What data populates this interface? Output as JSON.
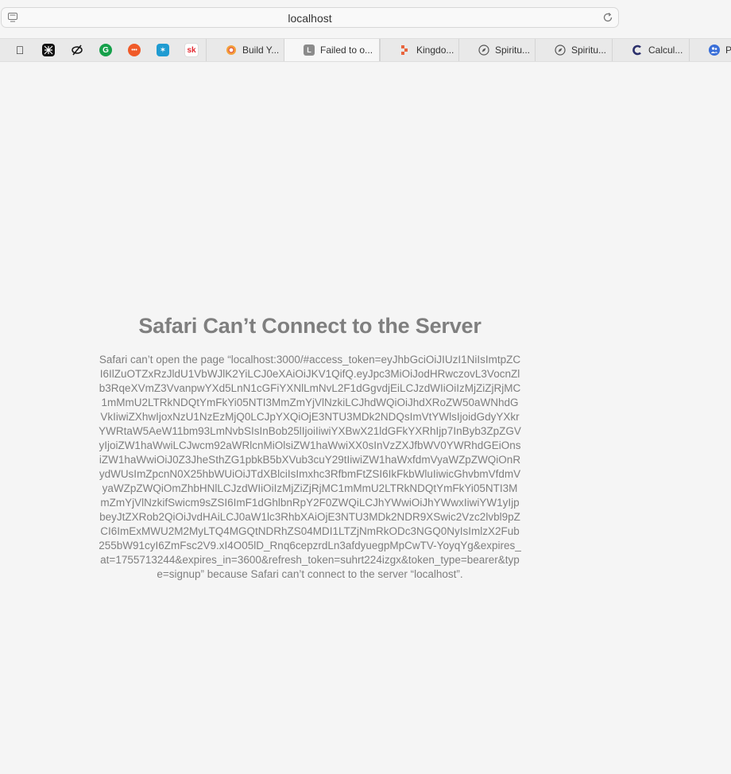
{
  "address_bar": {
    "url": "localhost"
  },
  "pinned_tabs": [
    {
      "icon": "apple-icon"
    },
    {
      "icon": "dark-pattern-icon"
    },
    {
      "icon": "perplexity-icon"
    },
    {
      "icon": "grammarly-icon"
    },
    {
      "icon": "orange-app-icon"
    },
    {
      "icon": "star-app-icon"
    },
    {
      "icon": "sk-icon",
      "text": "sk"
    }
  ],
  "tabs": [
    {
      "label": "Build Y...",
      "icon": "flower-icon"
    },
    {
      "label": "Failed to o...",
      "icon": "letter-l-icon",
      "icon_text": "L",
      "active": true
    },
    {
      "label": "Kingdo...",
      "icon": "kingdom-icon"
    },
    {
      "label": "Spiritu...",
      "icon": "compass-icon"
    },
    {
      "label": "Spiritu...",
      "icon": "compass-icon"
    },
    {
      "label": "Calcul...",
      "icon": "c-logo-icon"
    },
    {
      "label": "P",
      "icon": "people-icon"
    }
  ],
  "error": {
    "title": "Safari Can’t Connect to the Server",
    "message": "Safari can’t open the page “localhost:3000/#access_token=eyJhbGciOiJIUzI1NiIsImtpZCI6IlZuOTZxRzJldU1VbWJlK2YiLCJ0eXAiOiJKV1QifQ.eyJpc3MiOiJodHRwczovL3VocnZlb3RqeXVmZ3VvanpwYXd5LnN1cGFiYXNlLmNvL2F1dGgvdjEiLCJzdWIiOiIzMjZiZjRjMC1mMmU2LTRkNDQtYmFkYi05NTI3MmZmYjVlNzkiLCJhdWQiOiJhdXRoZW50aWNhdGVkIiwiZXhwIjoxNzU1NzEzMjQ0LCJpYXQiOjE3NTU3MDk2NDQsImVtYWlsIjoidGdyYXkrYWRtaW5AeW11bm93LmNvbSIsInBob25lIjoiIiwiYXBwX21ldGFkYXRhIjp7InByb3ZpZGVyIjoiZW1haWwiLCJwcm92aWRlcnMiOlsiZW1haWwiXX0sInVzZXJfbWV0YWRhdGEiOnsiZW1haWwiOiJ0Z3JheSthZG1pbkB5bXVub3cuY29tIiwiZW1haWxfdmVyaWZpZWQiOnRydWUsImZpcnN0X25hbWUiOiJTdXBlciIsImxhc3RfbmFtZSI6IkFkbWluIiwicGhvbmVfdmVyaWZpZWQiOmZhbHNlLCJzdWIiOiIzMjZiZjRjMC1mMmU2LTRkNDQtYmFkYi05NTI3MmZmYjVlNzkifSwicm9sZSI6ImF1dGhlbnRpY2F0ZWQiLCJhYWwiOiJhYWwxIiwiYW1yIjpbeyJtZXRob2QiOiJvdHAiLCJ0aW1lc3RhbXAiOjE3NTU3MDk2NDR9XSwic2Vzc2lvbl9pZCI6ImExMWU2M2MyLTQ4MGQtNDRhZS04MDI1LTZjNmRkODc3NGQ0NyIsImlzX2Fub255bW91cyI6ZmFsc2V9.xI4O05lD_Rnq6cepzrdLn3afdyuegpMpCwTV-YoyqYg&expires_at=1755713244&expires_in=3600&refresh_token=suhrt224izgx&token_type=bearer&type=signup” because Safari can’t connect to the server “localhost”."
  },
  "colors": {
    "background": "#f5f5f5",
    "error_text": "#7e7e7e"
  }
}
